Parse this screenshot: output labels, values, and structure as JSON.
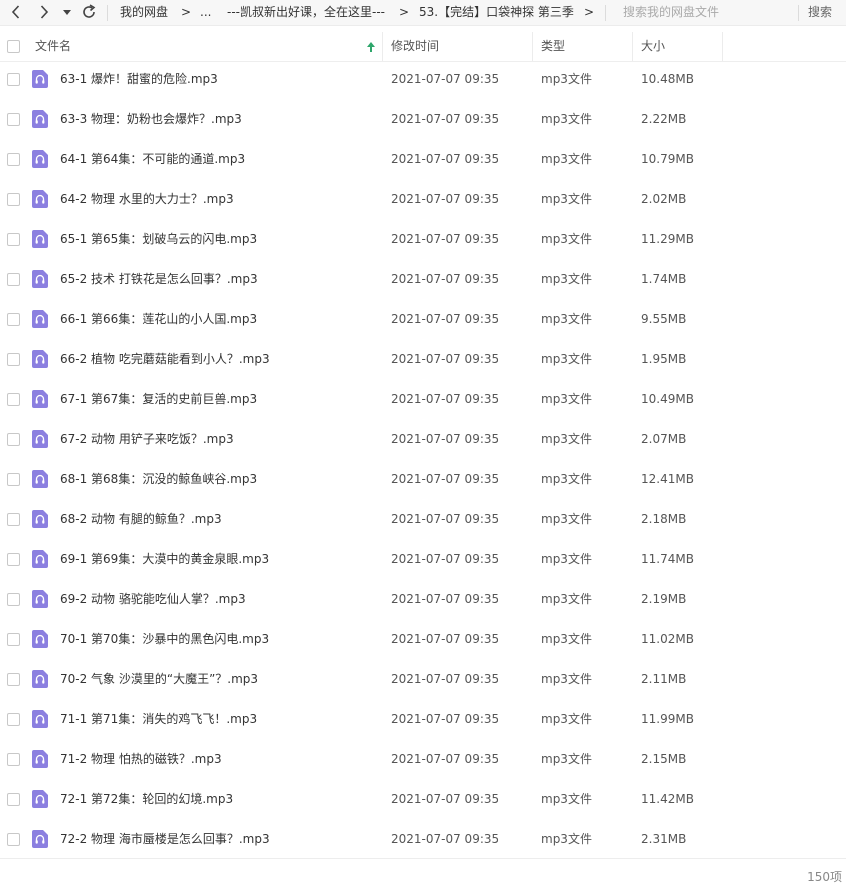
{
  "toolbar": {
    "breadcrumb": [
      "我的网盘",
      "...",
      "---凯叔新出好课，全在这里---",
      "53.【完结】口袋神探 第三季"
    ],
    "separator": ">",
    "search_placeholder": "搜索我的网盘文件",
    "search_label": "搜索"
  },
  "columns": {
    "name": "文件名",
    "modified": "修改时间",
    "type": "类型",
    "size": "大小"
  },
  "files": [
    {
      "name": "63-1 爆炸！甜蜜的危险.mp3",
      "modified": "2021-07-07 09:35",
      "type": "mp3文件",
      "size": "10.48MB"
    },
    {
      "name": "63-3 物理：奶粉也会爆炸？.mp3",
      "modified": "2021-07-07 09:35",
      "type": "mp3文件",
      "size": "2.22MB"
    },
    {
      "name": "64-1 第64集：不可能的通道.mp3",
      "modified": "2021-07-07 09:35",
      "type": "mp3文件",
      "size": "10.79MB"
    },
    {
      "name": "64-2 物理  水里的大力士？.mp3",
      "modified": "2021-07-07 09:35",
      "type": "mp3文件",
      "size": "2.02MB"
    },
    {
      "name": "65-1 第65集：划破乌云的闪电.mp3",
      "modified": "2021-07-07 09:35",
      "type": "mp3文件",
      "size": "11.29MB"
    },
    {
      "name": "65-2 技术  打铁花是怎么回事？.mp3",
      "modified": "2021-07-07 09:35",
      "type": "mp3文件",
      "size": "1.74MB"
    },
    {
      "name": "66-1 第66集：莲花山的小人国.mp3",
      "modified": "2021-07-07 09:35",
      "type": "mp3文件",
      "size": "9.55MB"
    },
    {
      "name": "66-2 植物  吃完蘑菇能看到小人？.mp3",
      "modified": "2021-07-07 09:35",
      "type": "mp3文件",
      "size": "1.95MB"
    },
    {
      "name": "67-1 第67集：复活的史前巨兽.mp3",
      "modified": "2021-07-07 09:35",
      "type": "mp3文件",
      "size": "10.49MB"
    },
    {
      "name": "67-2 动物  用铲子来吃饭？.mp3",
      "modified": "2021-07-07 09:35",
      "type": "mp3文件",
      "size": "2.07MB"
    },
    {
      "name": "68-1 第68集：沉没的鲸鱼峡谷.mp3",
      "modified": "2021-07-07 09:35",
      "type": "mp3文件",
      "size": "12.41MB"
    },
    {
      "name": "68-2 动物  有腿的鲸鱼？.mp3",
      "modified": "2021-07-07 09:35",
      "type": "mp3文件",
      "size": "2.18MB"
    },
    {
      "name": "69-1 第69集：大漠中的黄金泉眼.mp3",
      "modified": "2021-07-07 09:35",
      "type": "mp3文件",
      "size": "11.74MB"
    },
    {
      "name": "69-2 动物  骆驼能吃仙人掌？.mp3",
      "modified": "2021-07-07 09:35",
      "type": "mp3文件",
      "size": "2.19MB"
    },
    {
      "name": "70-1 第70集：沙暴中的黑色闪电.mp3",
      "modified": "2021-07-07 09:35",
      "type": "mp3文件",
      "size": "11.02MB"
    },
    {
      "name": "70-2 气象  沙漠里的“大魔王”？.mp3",
      "modified": "2021-07-07 09:35",
      "type": "mp3文件",
      "size": "2.11MB"
    },
    {
      "name": "71-1 第71集：消失的鸡飞飞！.mp3",
      "modified": "2021-07-07 09:35",
      "type": "mp3文件",
      "size": "11.99MB"
    },
    {
      "name": "71-2 物理  怕热的磁铁？.mp3",
      "modified": "2021-07-07 09:35",
      "type": "mp3文件",
      "size": "2.15MB"
    },
    {
      "name": "72-1 第72集：轮回的幻境.mp3",
      "modified": "2021-07-07 09:35",
      "type": "mp3文件",
      "size": "11.42MB"
    },
    {
      "name": "72-2 物理  海市蜃楼是怎么回事？.mp3",
      "modified": "2021-07-07 09:35",
      "type": "mp3文件",
      "size": "2.31MB"
    }
  ],
  "footer": {
    "count": "150项"
  },
  "icons": {
    "file": "audio-file-icon",
    "accent": "#8b7fe0",
    "sort": "#2ea66b"
  }
}
